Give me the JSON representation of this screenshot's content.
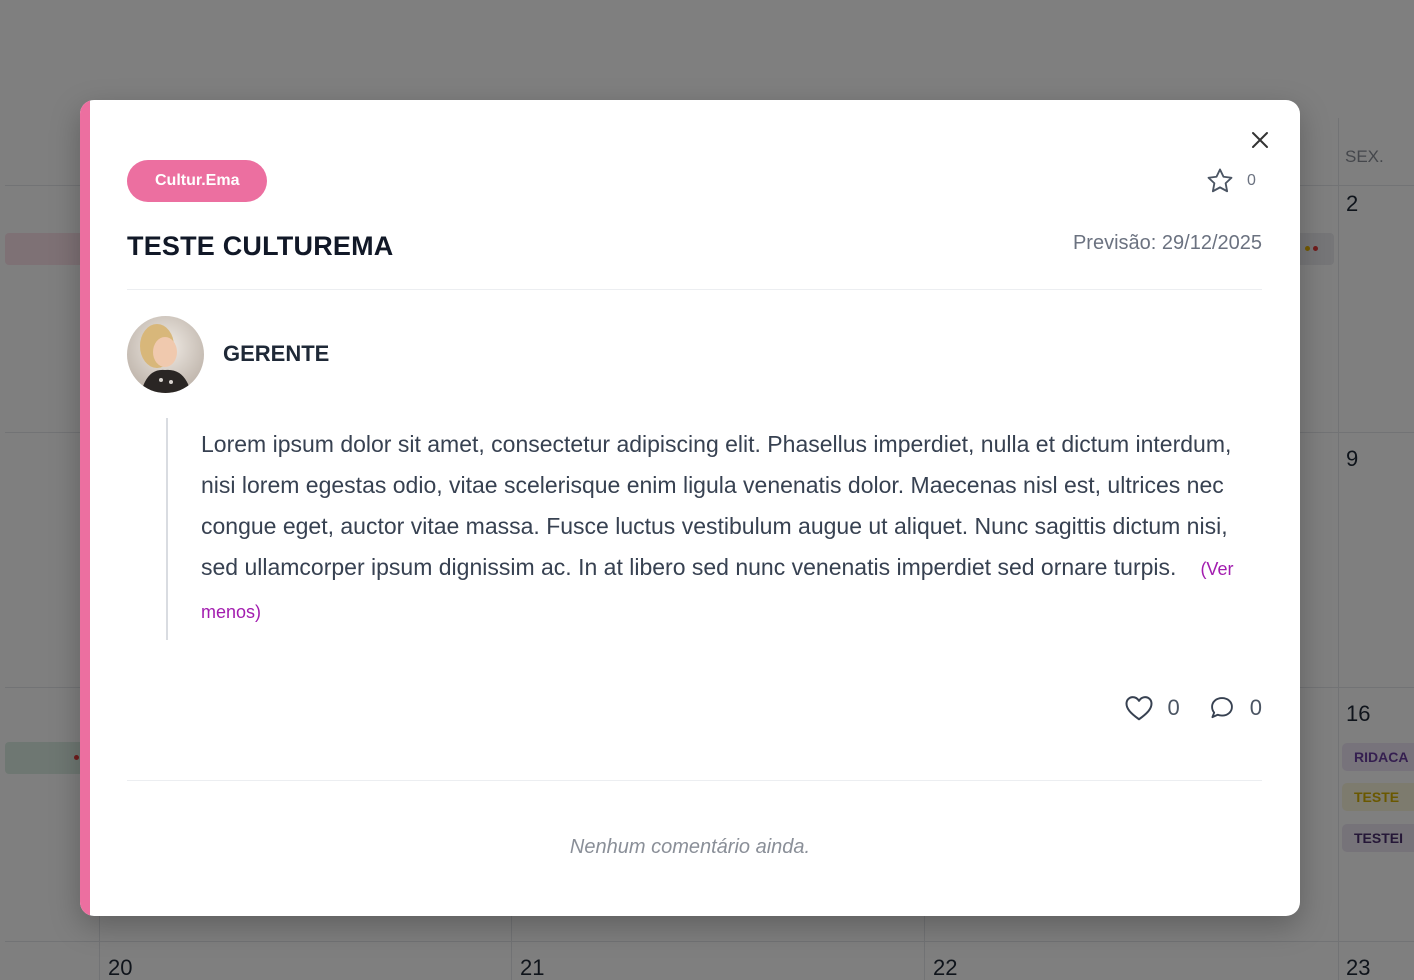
{
  "calendar": {
    "dayname_fri": "SEX.",
    "days": {
      "d2": "2",
      "d9": "9",
      "d16": "16",
      "d20": "20",
      "d21": "21",
      "d22": "22",
      "d23": "23"
    },
    "events": [
      {
        "label": "RIDACA",
        "color": "#6b3fa0",
        "bg": "#efe6f7"
      },
      {
        "label": "TESTE",
        "color": "#d4b000",
        "bg": "#fbf6dc"
      },
      {
        "label": "TESTEI",
        "color": "#4b2f6e",
        "bg": "#ece6f3"
      }
    ]
  },
  "modal": {
    "tag_label": "Cultur.Ema",
    "tag_color": "#ec6fa0",
    "favorite_icon": "star-icon",
    "favorite_count": "0",
    "title": "TESTE CULTUREMA",
    "forecast": "Previsão: 29/12/2025",
    "author": "GERENTE",
    "body": "Lorem ipsum dolor sit amet, consectetur adipiscing elit. Phasellus imperdiet, nulla et dictum interdum, nisi lorem egestas odio, vitae scelerisque enim ligula venenatis dolor. Maecenas nisl est, ultrices nec congue eget, auctor vitae massa. Fusce luctus vestibulum augue ut aliquet. Nunc sagittis dictum nisi, sed ullamcorper ipsum dignissim ac. In at libero sed nunc venenatis imperdiet sed ornare turpis.",
    "toggle_label": "(Ver menos)",
    "likes_icon": "heart-icon",
    "likes_count": "0",
    "comments_icon": "comment-icon",
    "comments_count": "0",
    "empty_comments": "Nenhum comentário ainda.",
    "close_icon": "close-icon"
  }
}
